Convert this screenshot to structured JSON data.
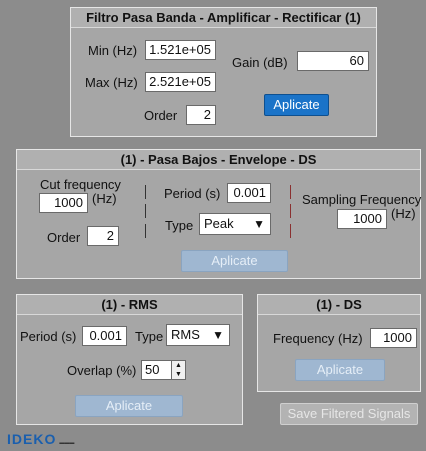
{
  "panel1": {
    "title": "Filtro Pasa Banda - Amplificar - Rectificar (1)",
    "min_label": "Min (Hz)",
    "min_value": "1.521e+05",
    "max_label": "Max (Hz)",
    "max_value": "2.521e+05",
    "gain_label": "Gain (dB)",
    "gain_value": "60",
    "order_label": "Order",
    "order_value": "2",
    "apply_label": "Aplicate"
  },
  "panel2": {
    "title": "(1) - Pasa Bajos - Envelope - DS",
    "cut_label": "Cut frequency",
    "cut_value": "1000",
    "cut_unit": "(Hz)",
    "order_label": "Order",
    "order_value": "2",
    "period_label": "Period (s)",
    "period_value": "0.001",
    "type_label": "Type",
    "type_value": "Peak",
    "sampling_label": "Sampling Frequency",
    "sampling_value": "1000",
    "sampling_unit": "(Hz)",
    "apply_label": "Aplicate"
  },
  "panel3": {
    "title": "(1) - RMS",
    "period_label": "Period (s)",
    "period_value": "0.001",
    "type_label": "Type",
    "type_value": "RMS",
    "overlap_label": "Overlap (%)",
    "overlap_value": "50",
    "apply_label": "Aplicate"
  },
  "panel4": {
    "title": "(1) - DS",
    "freq_label": "Frequency (Hz)",
    "freq_value": "1000",
    "apply_label": "Aplicate"
  },
  "save_label": "Save Filtered Signals",
  "logo": {
    "text": "IDEKO"
  },
  "colors": {
    "background": "#8c8c8c",
    "panel": "#a6a6a6",
    "primary_button": "#1a73c8",
    "disabled_button": "#9fb7d1"
  }
}
